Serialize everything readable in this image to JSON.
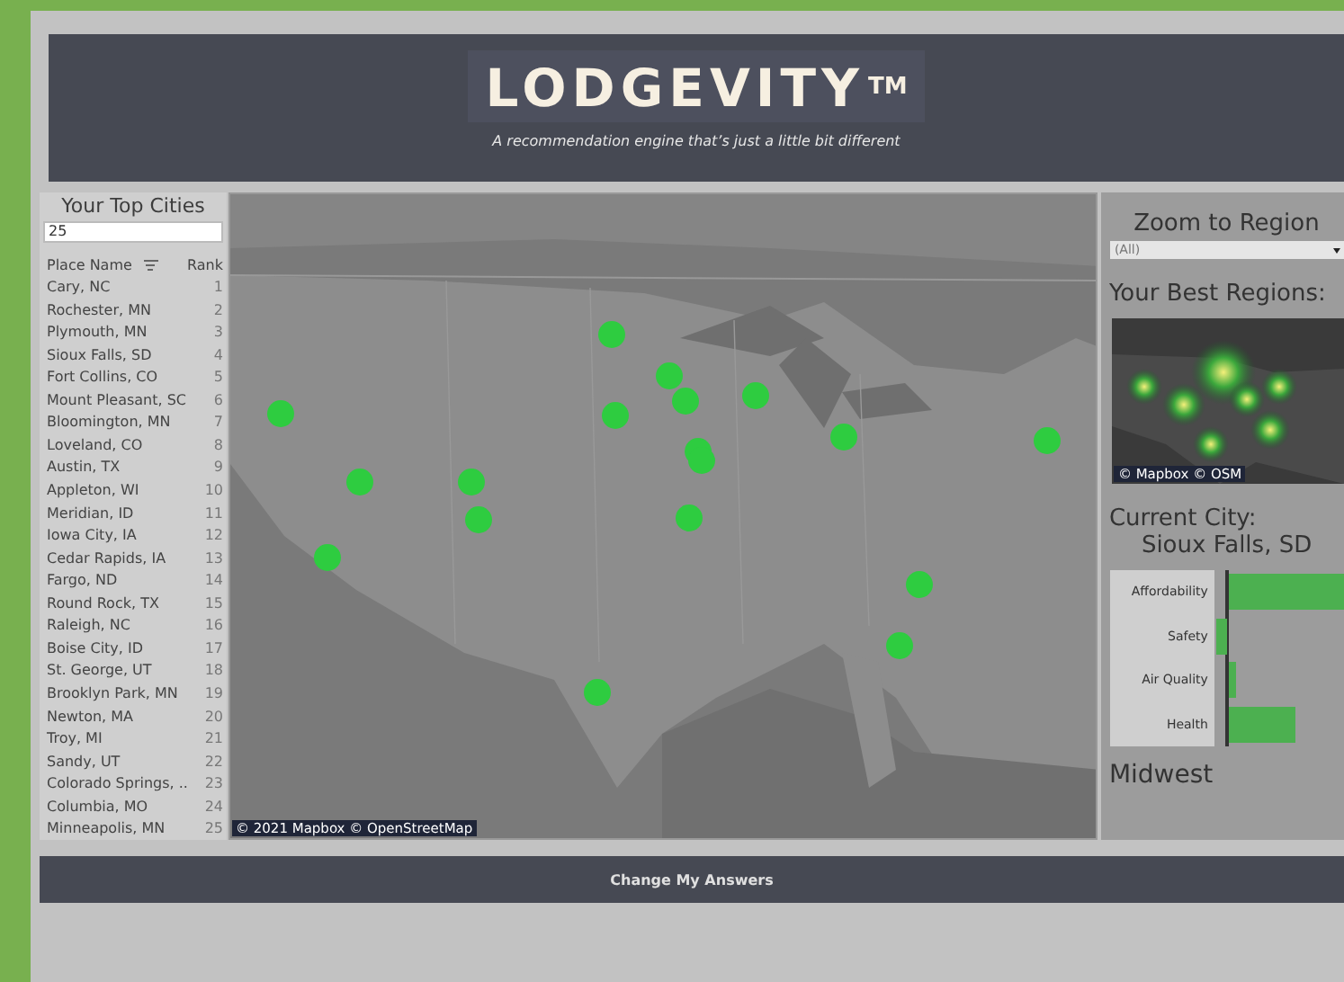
{
  "header": {
    "logo": "LODGEVITY",
    "trademark": "TM",
    "tagline": "A recommendation engine that’s just a little bit different"
  },
  "top_cities": {
    "title": "Your Top Cities",
    "count_field": "25",
    "columns": [
      "Place Name",
      "Rank"
    ],
    "rows": [
      {
        "place": "Cary, NC",
        "rank": "1"
      },
      {
        "place": "Rochester, MN",
        "rank": "2"
      },
      {
        "place": "Plymouth, MN",
        "rank": "3"
      },
      {
        "place": "Sioux Falls, SD",
        "rank": "4"
      },
      {
        "place": "Fort Collins, CO",
        "rank": "5"
      },
      {
        "place": "Mount Pleasant, SC",
        "rank": "6"
      },
      {
        "place": "Bloomington, MN",
        "rank": "7"
      },
      {
        "place": "Loveland, CO",
        "rank": "8"
      },
      {
        "place": "Austin, TX",
        "rank": "9"
      },
      {
        "place": "Appleton, WI",
        "rank": "10"
      },
      {
        "place": "Meridian, ID",
        "rank": "11"
      },
      {
        "place": "Iowa City, IA",
        "rank": "12"
      },
      {
        "place": "Cedar Rapids, IA",
        "rank": "13"
      },
      {
        "place": "Fargo, ND",
        "rank": "14"
      },
      {
        "place": "Round Rock, TX",
        "rank": "15"
      },
      {
        "place": "Raleigh, NC",
        "rank": "16"
      },
      {
        "place": "Boise City, ID",
        "rank": "17"
      },
      {
        "place": "St. George, UT",
        "rank": "18"
      },
      {
        "place": "Brooklyn Park, MN",
        "rank": "19"
      },
      {
        "place": "Newton, MA",
        "rank": "20"
      },
      {
        "place": "Troy, MI",
        "rank": "21"
      },
      {
        "place": "Sandy, UT",
        "rank": "22"
      },
      {
        "place": "Colorado Springs, ..",
        "rank": "23"
      },
      {
        "place": "Columbia, MO",
        "rank": "24"
      },
      {
        "place": "Minneapolis, MN",
        "rank": "25"
      }
    ]
  },
  "map": {
    "credit": "© 2021 Mapbox  © OpenStreetMap"
  },
  "zoom_to_region": {
    "title": "Zoom to Region",
    "value": "(All)"
  },
  "best_regions": {
    "title": "Your Best Regions:",
    "credit": "© Mapbox  © OSM"
  },
  "current_city": {
    "title": "Current City:",
    "city": "Sioux Falls, SD",
    "metrics": [
      {
        "label": "Affordability"
      },
      {
        "label": "Safety"
      },
      {
        "label": "Air Quality"
      },
      {
        "label": "Health"
      }
    ],
    "region": "Midwest"
  },
  "footer": {
    "button": "Change My Answers"
  }
}
